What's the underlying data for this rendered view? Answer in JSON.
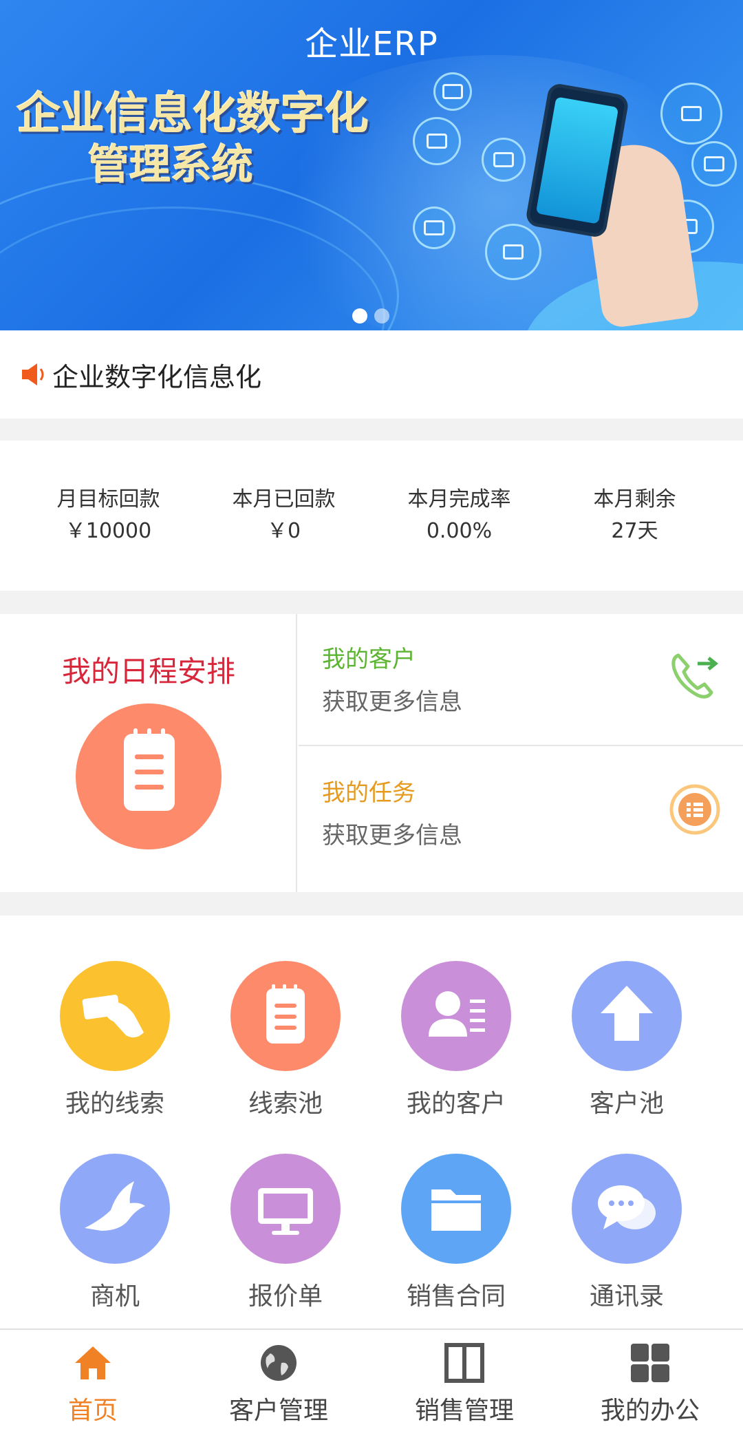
{
  "app": {
    "title": "企业ERP"
  },
  "banner": {
    "headline_line1": "企业信息化数字化",
    "headline_line2": "管理系统",
    "slide_count": 2,
    "active_slide": 1
  },
  "notice": {
    "text": "企业数字化信息化"
  },
  "stats": [
    {
      "label": "月目标回款",
      "value": "￥10000"
    },
    {
      "label": "本月已回款",
      "value": "￥0"
    },
    {
      "label": "本月完成率",
      "value": "0.00%"
    },
    {
      "label": "本月剩余",
      "value": "27天"
    }
  ],
  "quick": {
    "schedule": {
      "title": "我的日程安排",
      "color": "#d8263a",
      "icon": "notepad-icon"
    },
    "customers": {
      "title": "我的客户",
      "subtitle": "获取更多信息",
      "color": "#5cb531",
      "icon": "phone-forward-icon"
    },
    "tasks": {
      "title": "我的任务",
      "subtitle": "获取更多信息",
      "color": "#e69a1e",
      "icon": "task-list-icon"
    }
  },
  "grid": [
    {
      "label": "我的线索",
      "icon": "hand-card-icon",
      "color": "#fcc12f"
    },
    {
      "label": "线索池",
      "icon": "notepad-icon",
      "color": "#fd8a6a"
    },
    {
      "label": "我的客户",
      "icon": "contact-card-icon",
      "color": "#c98fd8"
    },
    {
      "label": "客户池",
      "icon": "upload-arrow-icon",
      "color": "#8fa8f8"
    },
    {
      "label": "商机",
      "icon": "dove-icon",
      "color": "#8fa8f8"
    },
    {
      "label": "报价单",
      "icon": "monitor-icon",
      "color": "#c98fd8"
    },
    {
      "label": "销售合同",
      "icon": "folder-icon",
      "color": "#5ea6f5"
    },
    {
      "label": "通讯录",
      "icon": "chat-bubbles-icon",
      "color": "#8fa8f8"
    }
  ],
  "tabs": [
    {
      "label": "首页",
      "icon": "home-icon",
      "active": true
    },
    {
      "label": "客户管理",
      "icon": "globe-icon",
      "active": false
    },
    {
      "label": "销售管理",
      "icon": "split-panel-icon",
      "active": false
    },
    {
      "label": "我的办公",
      "icon": "grid-icon",
      "active": false
    }
  ],
  "colors": {
    "accent": "#f08225",
    "background": "#f2f2f2"
  }
}
